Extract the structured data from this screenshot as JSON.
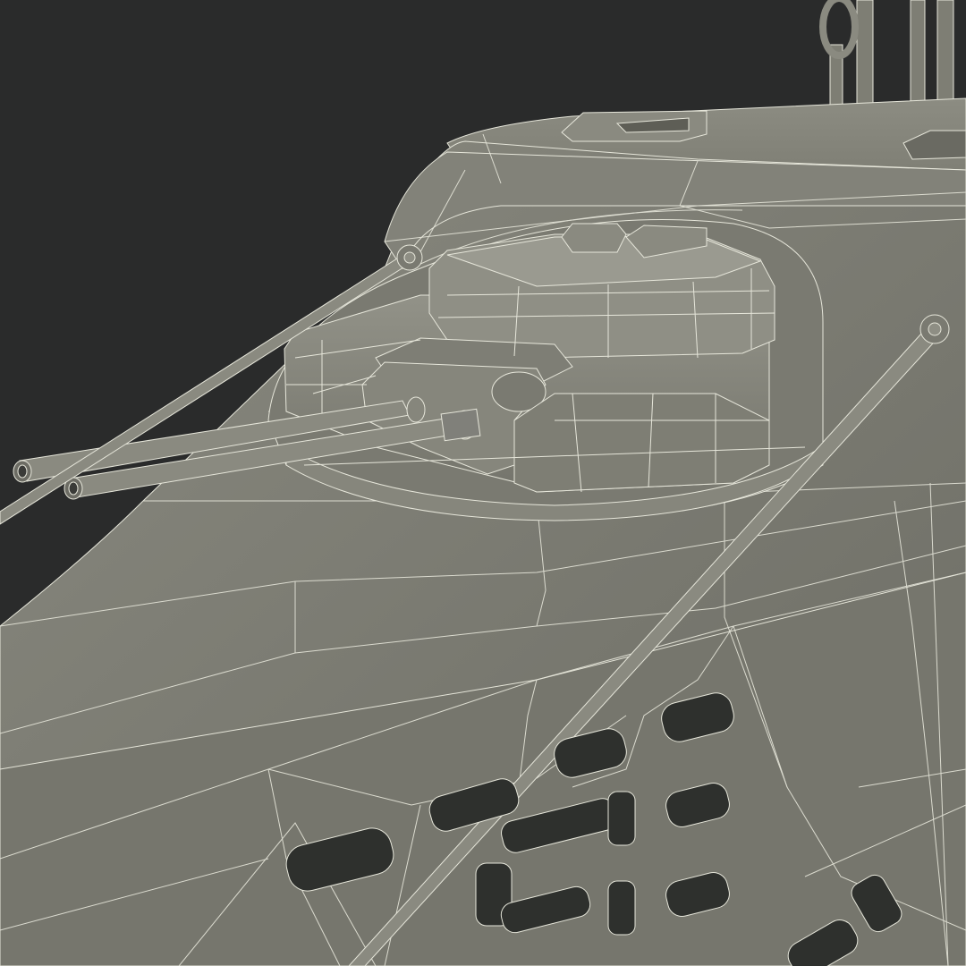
{
  "scene": {
    "subject": "wireframe-render",
    "colors": {
      "background": "#2a2b2b",
      "surface": "#7c7c72",
      "surface_light": "#8e8e84",
      "surface_dark": "#5e5e56",
      "wire": "#e6e6da",
      "vent_dark": "#2e302d"
    }
  }
}
